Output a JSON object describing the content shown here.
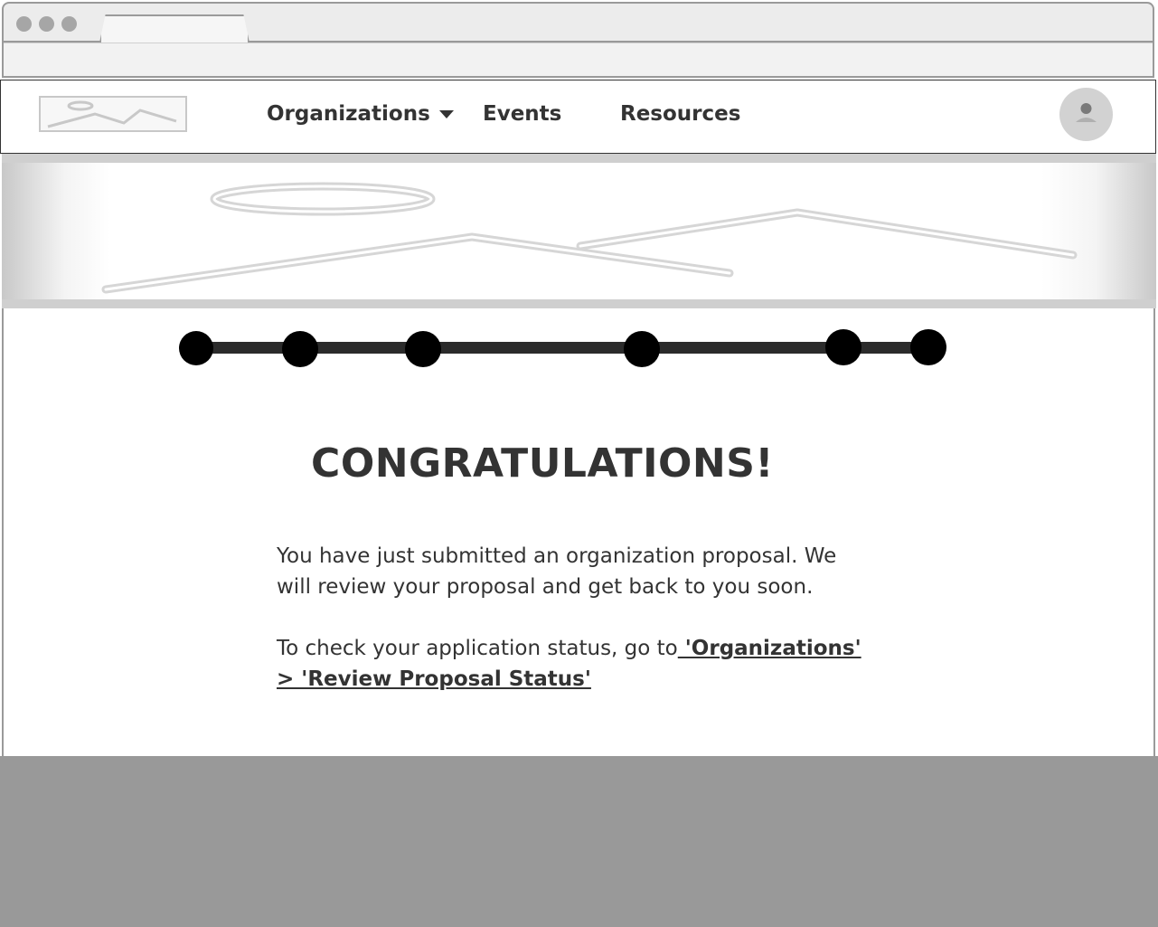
{
  "nav": {
    "items": [
      {
        "label": "Organizations",
        "has_dropdown": true
      },
      {
        "label": "Events"
      },
      {
        "label": "Resources"
      }
    ]
  },
  "progress": {
    "steps_total": 6
  },
  "main": {
    "heading": "CONGRATULATIONS!",
    "paragraph1": "You have just submitted an organization proposal. We will review your proposal and get back to you soon.",
    "paragraph2_prefix": "To check your application status, go to",
    "paragraph2_link": " 'Organizations' > 'Review Proposal Status'"
  },
  "icons": [
    "logo-placeholder-image-icon",
    "chevron-down-icon",
    "user-avatar-icon",
    "hero-placeholder-image-icon"
  ],
  "colors": {
    "text": "#333333",
    "footer": "#999999",
    "placeholder_stroke": "#c8c8c8",
    "progress": "#000000"
  }
}
